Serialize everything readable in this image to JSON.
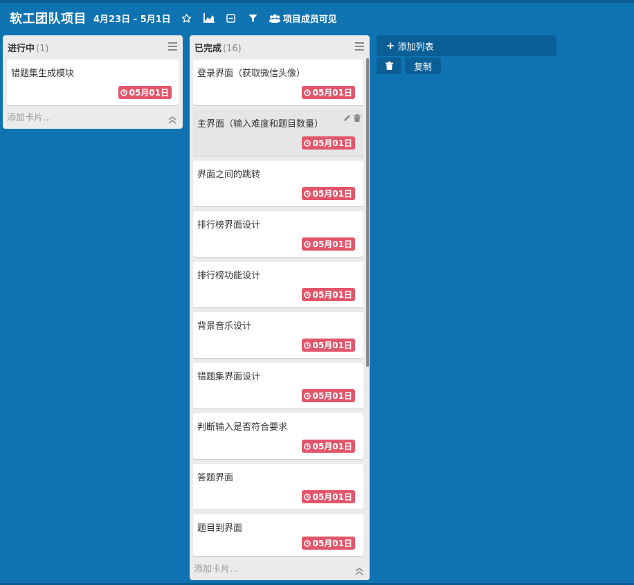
{
  "header": {
    "title": "软工团队项目",
    "dates": "4月23日 - 5月1日",
    "members_label": "项目成员可见",
    "icons": [
      "star-icon",
      "chart-icon",
      "collapse-box-icon",
      "filter-icon",
      "users-icon"
    ]
  },
  "lists": [
    {
      "name": "进行中",
      "count": "(1)",
      "add_card": "添加卡片...",
      "cards": [
        {
          "title": "错题集生成模块",
          "due": "05月01日"
        }
      ]
    },
    {
      "name": "已完成",
      "count": "(16)",
      "add_card": "添加卡片...",
      "cards": [
        {
          "title": "登录界面（获取微信头像）",
          "due": "05月01日"
        },
        {
          "title": "主界面（输入难度和题目数量）",
          "due": "05月01日"
        },
        {
          "title": "界面之间的跳转",
          "due": "05月01日"
        },
        {
          "title": "排行榜界面设计",
          "due": "05月01日"
        },
        {
          "title": "排行榜功能设计",
          "due": "05月01日"
        },
        {
          "title": "背景音乐设计",
          "due": "05月01日"
        },
        {
          "title": "错题集界面设计",
          "due": "05月01日"
        },
        {
          "title": "判断输入是否符合要求",
          "due": "05月01日"
        },
        {
          "title": "答题界面",
          "due": "05月01日"
        },
        {
          "title": "题目到界面",
          "due": "05月01日"
        }
      ]
    }
  ],
  "actions": {
    "add_list": "添加列表",
    "copy": "复制"
  },
  "colors": {
    "background": "#0f73b2",
    "due_badge": "#e2566b",
    "list_bg": "#ebebeb"
  }
}
